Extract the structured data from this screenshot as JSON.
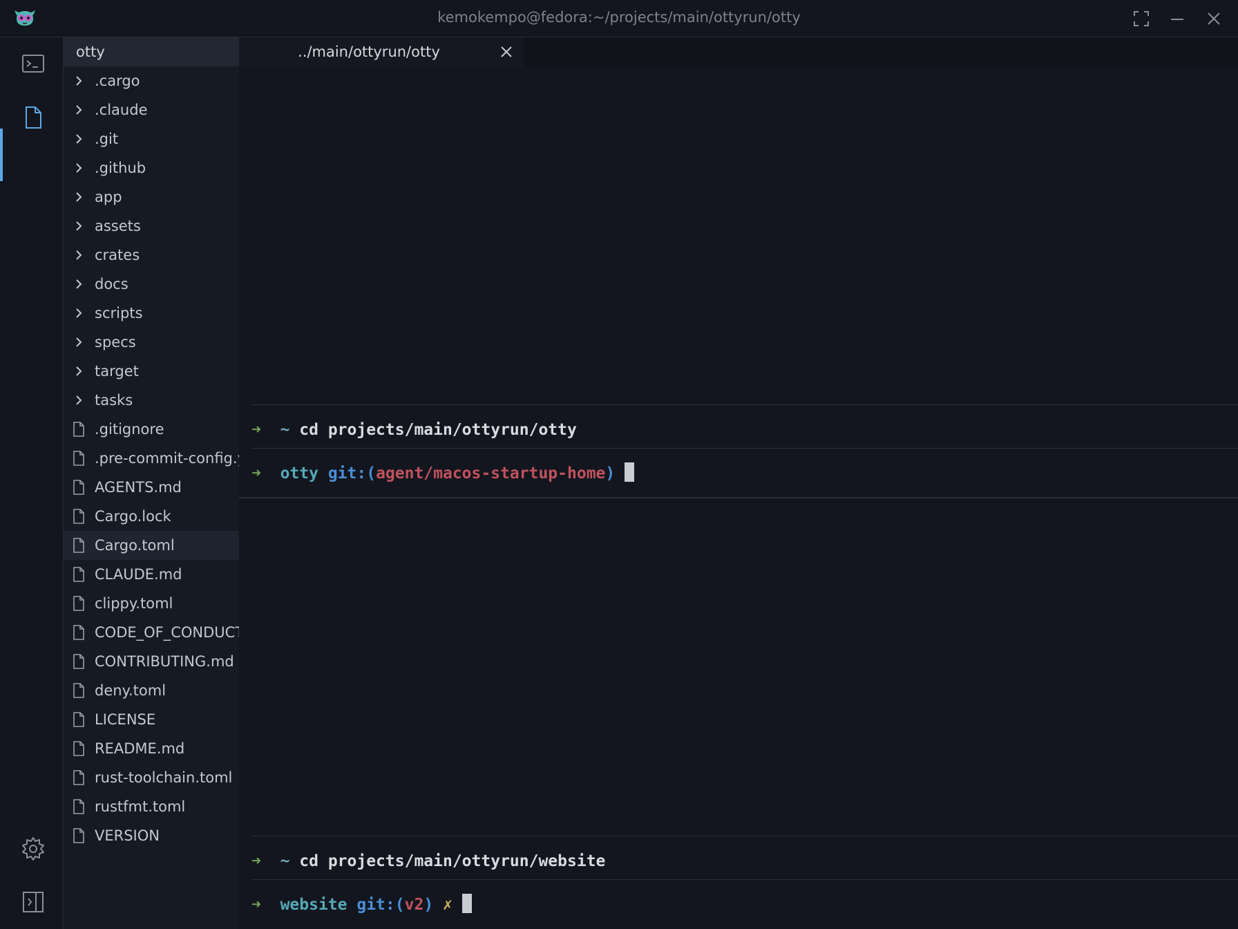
{
  "window": {
    "title": "kemokempo@fedora:~/projects/main/ottyrun/otty"
  },
  "sidebar": {
    "header": "otty",
    "folders": [
      ".cargo",
      ".claude",
      ".git",
      ".github",
      "app",
      "assets",
      "crates",
      "docs",
      "scripts",
      "specs",
      "target",
      "tasks"
    ],
    "files": [
      ".gitignore",
      ".pre-commit-config.yaml",
      "AGENTS.md",
      "Cargo.lock",
      "Cargo.toml",
      "CLAUDE.md",
      "clippy.toml",
      "CODE_OF_CONDUCT.md",
      "CONTRIBUTING.md",
      "deny.toml",
      "LICENSE",
      "README.md",
      "rust-toolchain.toml",
      "rustfmt.toml",
      "VERSION"
    ]
  },
  "tab": {
    "label": "../main/ottyrun/otty"
  },
  "pane1": {
    "cmd": {
      "arrow": "➜",
      "tilde": "~",
      "command": "cd projects/main/ottyrun/otty"
    },
    "prompt": {
      "arrow": "➜",
      "dir": "otty",
      "git_label": "git:(",
      "branch": "agent/macos-startup-home",
      "git_close": ")"
    }
  },
  "pane2": {
    "cmd": {
      "arrow": "➜",
      "tilde": "~",
      "command": "cd projects/main/ottyrun/website"
    },
    "prompt": {
      "arrow": "➜",
      "dir": "website",
      "git_label": "git:(",
      "branch": "v2",
      "git_close": ")",
      "dirty": "✗"
    }
  },
  "colors": {
    "accent": "#5aa9e6",
    "background": "#13161e",
    "sidebar": "#161a22"
  }
}
